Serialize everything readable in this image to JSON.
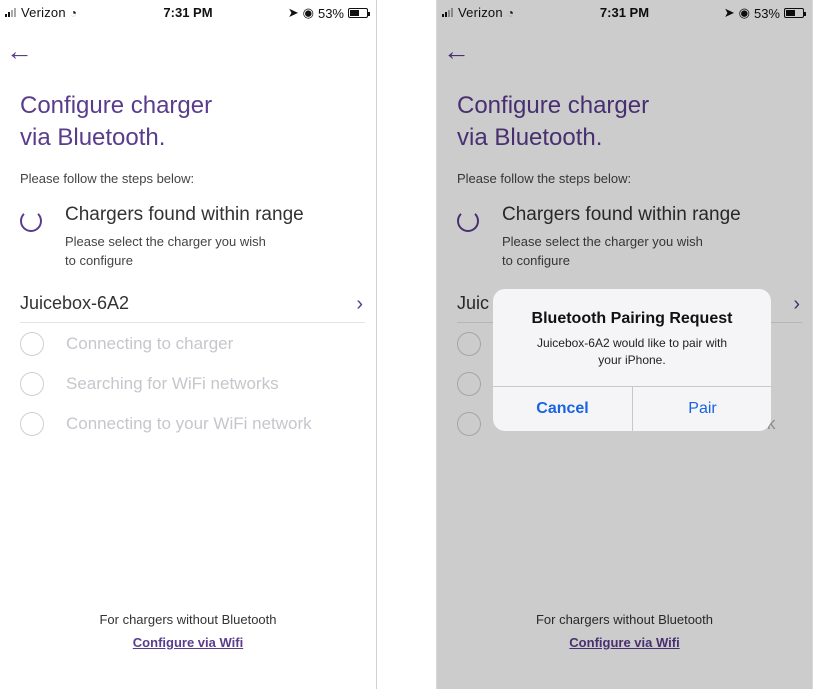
{
  "colors": {
    "accent": "#5a3c8c",
    "link_blue": "#1a64e0",
    "muted": "#c6c6cc"
  },
  "status_bar": {
    "carrier": "Verizon",
    "time": "7:31 PM",
    "battery_pct": "53%",
    "battery_level": 0.53
  },
  "screen": {
    "back_icon": "left-arrow-icon",
    "title": "Configure charger\nvia Bluetooth.",
    "subtitle": "Please follow the steps below:",
    "active_step": {
      "title": "Chargers found within range",
      "description": "Please select the charger you wish\nto configure"
    },
    "charger": {
      "name": "Juicebox-6A2",
      "chevron_icon": "chevron-right-icon"
    },
    "pending_steps": [
      {
        "label": "Connecting to charger"
      },
      {
        "label": "Searching for WiFi networks"
      },
      {
        "label": "Connecting to your WiFi network"
      }
    ],
    "footer": {
      "text": "For chargers without Bluetooth",
      "link": "Configure via Wifi"
    }
  },
  "screen2": {
    "charger_visible_prefix": "Juic",
    "obscured_tail": "k"
  },
  "alert": {
    "title": "Bluetooth Pairing Request",
    "message": "Juicebox-6A2 would like to pair with\nyour iPhone.",
    "cancel": "Cancel",
    "pair": "Pair"
  }
}
